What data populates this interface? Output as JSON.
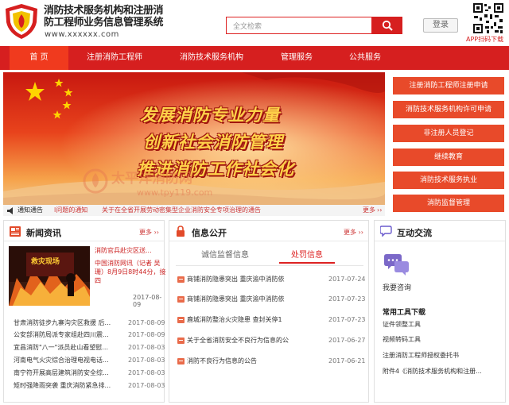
{
  "header": {
    "title_line1": "消防技术服务机构和注册消",
    "title_line2": "防工程师业务信息管理系统",
    "url": "www.xxxxxx.com",
    "search_placeholder": "全文检索",
    "login_label": "登录",
    "qr_label": "APP扫码下载"
  },
  "nav": {
    "items": [
      {
        "label": "首 页",
        "active": true
      },
      {
        "label": "注册消防工程师",
        "active": false
      },
      {
        "label": "消防技术服务机构",
        "active": false
      },
      {
        "label": "管理服务",
        "active": false
      },
      {
        "label": "公共服务",
        "active": false
      }
    ]
  },
  "banner": {
    "slogan1": "发展消防专业力量",
    "slogan2": "创新社会消防管理",
    "slogan3": "推进消防工作社会化",
    "watermark1": "太平洋消防网",
    "watermark2": "www.tpy119.com"
  },
  "notice": {
    "label": "通知通告",
    "item1": "l问题的通知",
    "item2": "关于在全省开展劳动密集型企业消防安全专项治理的通告",
    "more": "更多"
  },
  "quick_links": [
    "注册消防工程师注册申请",
    "消防技术服务机构许可申请",
    "非注册人员登记",
    "继续教育",
    "消防技术服务执业",
    "消防监督管理"
  ],
  "news": {
    "title": "新闻资讯",
    "more": "更多",
    "featured_title": "消防官兵赴灾区送...",
    "featured_summary": "中国消防网讯（记者 吴珊）8月9日8时44分，接四",
    "featured_date": "2017-08-09",
    "items": [
      {
        "title": "甘肃消防徒步九寨沟灾区救援 后...",
        "date": "2017-08-09"
      },
      {
        "title": "公安部消防局派专家组赴四川震...",
        "date": "2017-08-09"
      },
      {
        "title": "宜昌消防\"八一\"派员赴山看望慰...",
        "date": "2017-08-03"
      },
      {
        "title": "河南电气火灾综合治理电视电话...",
        "date": "2017-08-03"
      },
      {
        "title": "南宁符开展高层建筑消防安全综...",
        "date": "2017-08-03"
      },
      {
        "title": "矩时强降雨突袭 重庆消防紧急排...",
        "date": "2017-08-03"
      }
    ]
  },
  "info": {
    "title": "信息公开",
    "more": "更多",
    "tab1": "诚信监督信息",
    "tab2": "处罚信息",
    "items": [
      {
        "title": "商铺消防隐患突出 重庆渝中消防依",
        "date": "2017-07-24"
      },
      {
        "title": "商铺消防隐患突出 重庆渝中消防依",
        "date": "2017-07-23"
      },
      {
        "title": "鹿城消防整治火灾隐患 查封关停1",
        "date": "2017-07-23"
      },
      {
        "title": "关于全省消防安全不良行为信息的公",
        "date": "2017-06-27"
      },
      {
        "title": "消防不良行为信息的公告",
        "date": "2017-06-21"
      }
    ]
  },
  "interact": {
    "title": "互动交流",
    "consult_label": "我要咨询",
    "tools_title": "常用工具下载",
    "tools": [
      "证件领整工具",
      "视频转码工具",
      "注册消防工程师授权委托书",
      "附件4《消防技术服务机构和注册..."
    ]
  },
  "colors": {
    "brand_red": "#d61f1f",
    "quick_link_orange": "#e84a2a"
  }
}
